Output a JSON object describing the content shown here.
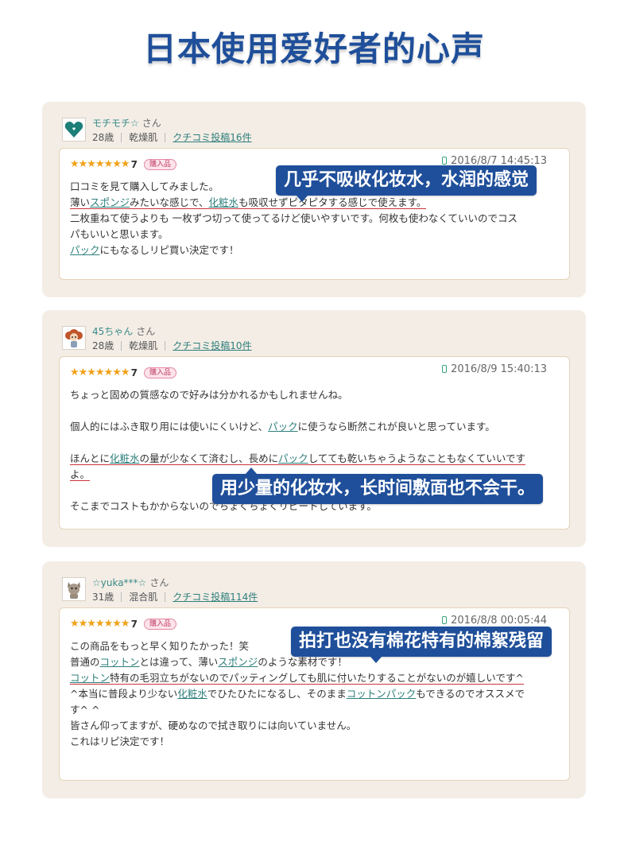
{
  "page_title": "日本使用爱好者的心声",
  "colors": {
    "accent": "#1f4f9a",
    "link": "#2e7f7b",
    "star": "#f0a21a",
    "card_bg": "#f3ede6"
  },
  "reviews": [
    {
      "user_name": "モチモチ☆",
      "honorific": "さん",
      "age": "28歳",
      "skin": "乾燥肌",
      "posts": "クチコミ投稿16件",
      "avatar_icon": "heart-avatar-icon",
      "stars": "★★★★★★★",
      "rating": "7",
      "badge": "購入品",
      "date": "2016/8/7 14:45:13",
      "lines": [
        [
          "口コミを見て購入してみました。"
        ],
        [
          "薄い",
          "スポンジ",
          "みたいな感じで、",
          "化粧水",
          "も吸収せずピタピタする感じで使えます。"
        ],
        [
          "二枚重ねて使うよりも 一枚ずつ切って使ってるけど使いやすいです。何枚も使わなくていいのでコス"
        ],
        [
          "パもいいと思います。"
        ],
        [
          "パック",
          "にもなるしリピ買い決定です！"
        ]
      ],
      "callout": "几乎不吸收化妆水，水润的感觉"
    },
    {
      "user_name": "45ちゃん",
      "honorific": "さん",
      "age": "28歳",
      "skin": "乾燥肌",
      "posts": "クチコミ投稿10件",
      "avatar_icon": "girl-avatar-icon",
      "stars": "★★★★★★★",
      "rating": "7",
      "badge": "購入品",
      "date": "2016/8/9 15:40:13",
      "lines": [
        [
          "ちょっと固めの質感なので好みは分かれるかもしれませんね。"
        ],
        [],
        [
          "個人的にはふき取り用には使いにくいけど、",
          "パック",
          "に使うなら断然これが良いと思っています。"
        ],
        [],
        [
          "ほんとに",
          "化粧水",
          "の量が少なくて済むし、長めに",
          "パック",
          "してても乾いちゃうようなこともなくていいです"
        ],
        [
          "よ。"
        ],
        [],
        [
          "そこまでコストもかからないのでちょくちょくリピートしています。"
        ]
      ],
      "callout": "用少量的化妆水，长时间敷面也不会干。"
    },
    {
      "user_name": "☆yuka***☆",
      "honorific": "さん",
      "age": "31歳",
      "skin": "混合肌",
      "posts": "クチコミ投稿114件",
      "avatar_icon": "cat-avatar-icon",
      "stars": "★★★★★★★",
      "rating": "7",
      "badge": "購入品",
      "date": "2016/8/8 00:05:44",
      "lines": [
        [
          "この商品をもっと早く知りたかった！笑"
        ],
        [
          "普通の",
          "コットン",
          "とは違って、薄い",
          "スポンジ",
          "のような素材です！"
        ],
        [
          "コットン",
          "特有の毛羽立ちがないのでパッティングしても肌に付いたりすることがないのが嬉しいです^"
        ],
        [
          "^本当に普段より少ない",
          "化粧水",
          "でひたひたになるし、そのまま",
          "コットンパック",
          "もできるのでオススメで"
        ],
        [
          "す^ ^"
        ],
        [
          "皆さん仰ってますが、硬めなので拭き取りには向いていません。"
        ],
        [
          "これはリピ決定です！"
        ]
      ],
      "callout": "拍打也没有棉花特有的棉絮残留"
    }
  ]
}
